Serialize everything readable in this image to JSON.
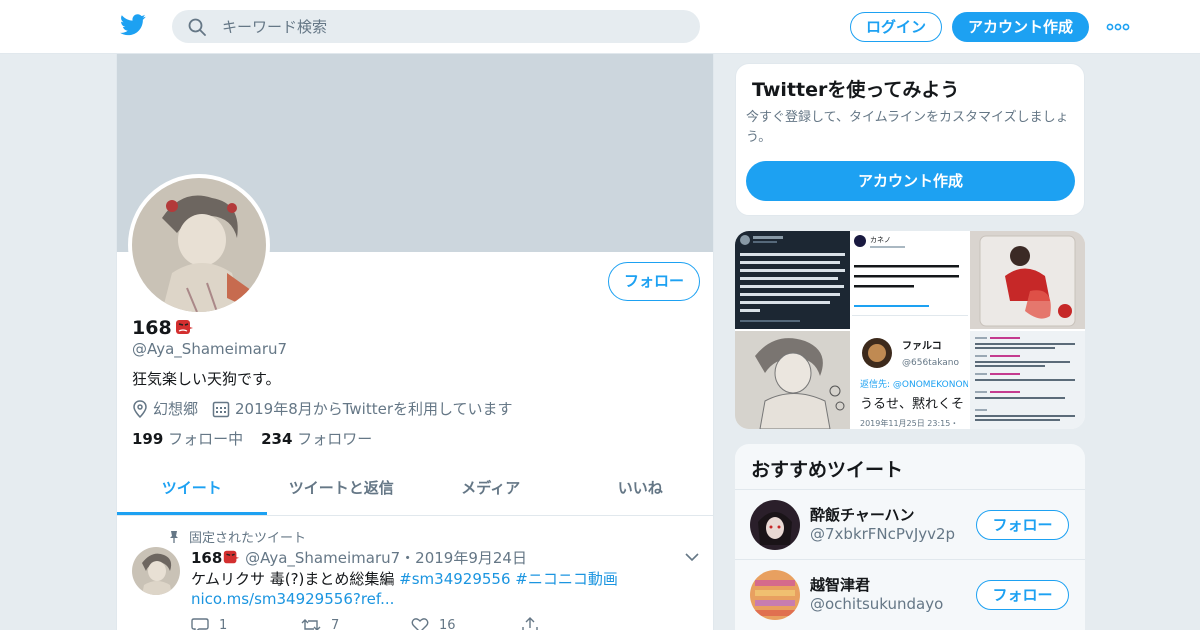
{
  "header": {
    "search_placeholder": "キーワード検索",
    "login_label": "ログイン",
    "signup_label": "アカウント作成",
    "brand_color": "#1da1f2"
  },
  "profile": {
    "name": "168",
    "handle": "@Aya_Shameimaru7",
    "bio": "狂気楽しい天狗です。",
    "location": "幻想郷",
    "joined": "2019年8月からTwitterを利用しています",
    "following_count": "199",
    "following_label": "フォロー中",
    "followers_count": "234",
    "followers_label": "フォロワー",
    "follow_label": "フォロー",
    "tabs": [
      "ツイート",
      "ツイートと返信",
      "メディア",
      "いいね"
    ]
  },
  "pinned_tweet": {
    "pinned_label": "固定されたツイート",
    "name": "168",
    "handle_date": "@Aya_Shameimaru7・2019年9月24日",
    "text": "ケムリクサ 毒(?)まとめ総集編 ",
    "hashtag1": "#sm34929556",
    "hashtag2": "#ニコニコ動画",
    "link": "nico.ms/sm34929556?ref...",
    "replies": "1",
    "retweets": "7",
    "likes": "16"
  },
  "signup_card": {
    "title": "Twitterを使ってみよう",
    "description": "今すぐ登録して、タイムラインをカスタマイズしましょう。",
    "button_label": "アカウント作成"
  },
  "media_thumbs": {
    "reply_name": "ファルコ",
    "reply_handle": "@656takano",
    "reply_to": "返信先: @ONOMEKONON",
    "reply_text": "うるせ、黙れくそ",
    "reply_date": "2019年11月25日 23:15・",
    "tweet_handle": "カネノ",
    "tweet_text": "して何とかなると思っているのな\n大間違いだという事を持って\nるがよい。"
  },
  "recommended": {
    "title": "おすすめツイート",
    "follow_label": "フォロー",
    "items": [
      {
        "name": "酔飯チャーハン",
        "handle": "@7xbkrFNcPvJyv2p"
      },
      {
        "name": "越智津君",
        "handle": "@ochitsukundayo"
      }
    ]
  }
}
